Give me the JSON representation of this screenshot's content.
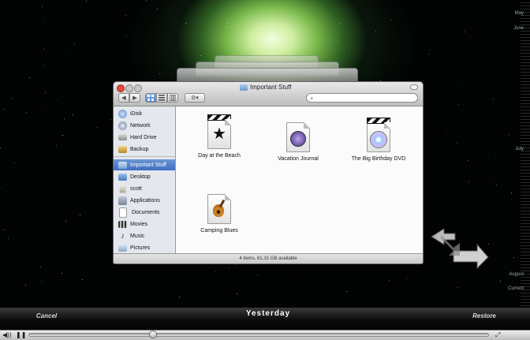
{
  "finder": {
    "title": "Important Stuff",
    "toolbar": {
      "back": "◀",
      "forward": "▶",
      "action": "⚙▾"
    },
    "sidebar": [
      {
        "label": "iDisk",
        "icon": "idisk-icon"
      },
      {
        "label": "Network",
        "icon": "network-icon"
      },
      {
        "label": "Hard Drive",
        "icon": "hard-drive-icon"
      },
      {
        "label": "Backup",
        "icon": "backup-drive-icon"
      },
      {
        "label": "Important Stuff",
        "icon": "folder-icon",
        "selected": true
      },
      {
        "label": "Desktop",
        "icon": "desktop-icon"
      },
      {
        "label": "scott",
        "icon": "home-icon"
      },
      {
        "label": "Applications",
        "icon": "applications-icon"
      },
      {
        "label": "Documents",
        "icon": "documents-icon"
      },
      {
        "label": "Movies",
        "icon": "movies-icon"
      },
      {
        "label": "Music",
        "icon": "music-icon"
      },
      {
        "label": "Pictures",
        "icon": "pictures-icon"
      }
    ],
    "files": [
      {
        "name": "Day at the Beach",
        "icon": "imovie-project-icon"
      },
      {
        "name": "Vacation  Journal",
        "icon": "document-icon"
      },
      {
        "name": "The Big Birthday DVD",
        "icon": "idvd-project-icon"
      },
      {
        "name": "Camping Blues",
        "icon": "garageband-icon"
      }
    ],
    "status": "4 items, 81.15 GB available"
  },
  "timeline": {
    "labels": [
      "May",
      "June",
      "July",
      "August",
      "Current"
    ]
  },
  "controls": {
    "cancel": "Cancel",
    "title": "Yesterday",
    "restore": "Restore"
  },
  "player": {
    "vol_label": "◀))",
    "pause_label": "❚❚",
    "fullscreen_label": "⤢",
    "progress_percent": 27
  },
  "colors": {
    "selection": "#3e6ec0",
    "nebula": "#9ad36a"
  }
}
